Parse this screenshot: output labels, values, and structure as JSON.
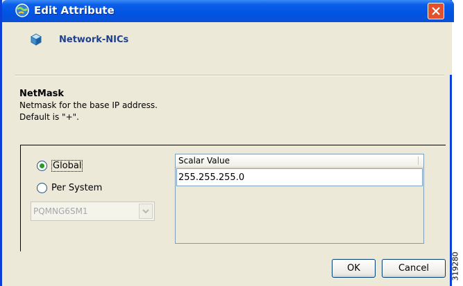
{
  "window": {
    "title": "Edit Attribute",
    "icons": {
      "app": "app-globe-icon",
      "close": "close-icon"
    }
  },
  "header": {
    "label": "Network-NICs",
    "icon": "cube-icon"
  },
  "property": {
    "name": "NetMask",
    "description_line1": "Netmask for the base IP address.",
    "description_line2": "Default is \"+\"."
  },
  "scope": {
    "options": [
      {
        "label": "Global",
        "selected": true
      },
      {
        "label": "Per System",
        "selected": false
      }
    ],
    "system_select": {
      "value": "PQMNG6SM1",
      "enabled": false
    }
  },
  "value_table": {
    "header": "Scalar Value",
    "rows": [
      "255.255.255.0"
    ]
  },
  "buttons": {
    "ok": "OK",
    "cancel": "Cancel"
  },
  "side_id": "319280",
  "colors": {
    "titlebar": "#0054e3",
    "window_bg": "#ece9d8",
    "close": "#e2502c",
    "header_text": "#1f3f8f",
    "radio_dot": "#21a121"
  }
}
